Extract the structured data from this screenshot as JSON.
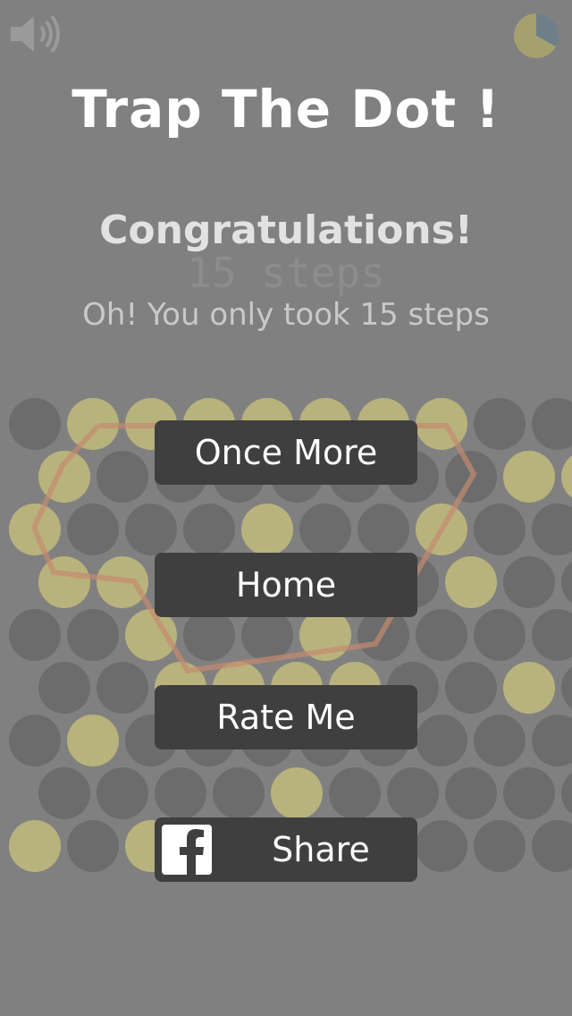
{
  "title": "Trap The Dot !",
  "result": {
    "congratulations": "Congratulations!",
    "steps_ghost": "15 steps",
    "message": "Oh! You only took 15 steps"
  },
  "buttons": {
    "once_more": "Once More",
    "home": "Home",
    "rate_me": "Rate Me",
    "share": "Share"
  },
  "icons": {
    "sound": "speaker-icon",
    "progress": "pie-icon",
    "facebook": "facebook-icon"
  },
  "board": {
    "rows": 9,
    "cols": 9,
    "blocked_color": "#b8b37c",
    "empty_color": "#6c6c6c",
    "highlight_color": "#c58a6f",
    "blocked": [
      [
        0,
        1
      ],
      [
        0,
        2
      ],
      [
        0,
        3
      ],
      [
        0,
        4
      ],
      [
        0,
        5
      ],
      [
        0,
        6
      ],
      [
        0,
        7
      ],
      [
        1,
        0
      ],
      [
        1,
        8
      ],
      [
        1,
        9
      ],
      [
        2,
        0
      ],
      [
        2,
        4
      ],
      [
        2,
        7
      ],
      [
        3,
        0
      ],
      [
        3,
        1
      ],
      [
        3,
        7
      ],
      [
        4,
        2
      ],
      [
        4,
        5
      ],
      [
        5,
        2
      ],
      [
        5,
        3
      ],
      [
        5,
        4
      ],
      [
        5,
        5
      ],
      [
        5,
        8
      ],
      [
        6,
        1
      ],
      [
        7,
        4
      ],
      [
        8,
        0
      ],
      [
        8,
        2
      ]
    ]
  }
}
